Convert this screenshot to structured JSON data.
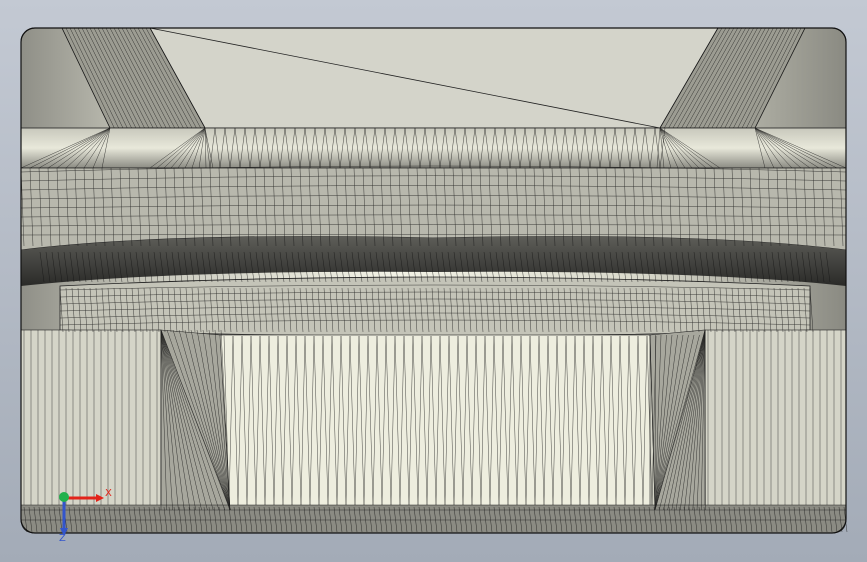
{
  "viewport": {
    "background_top": "#c3c9d3",
    "background_bottom": "#a3abb7",
    "model_fill": "#d6d6cc",
    "mesh_stroke": "#141414"
  },
  "triad": {
    "x_label": "X",
    "z_label": "Z",
    "x_color": "#e2231a",
    "y_color": "#22b14c",
    "z_color": "#3355cc"
  }
}
